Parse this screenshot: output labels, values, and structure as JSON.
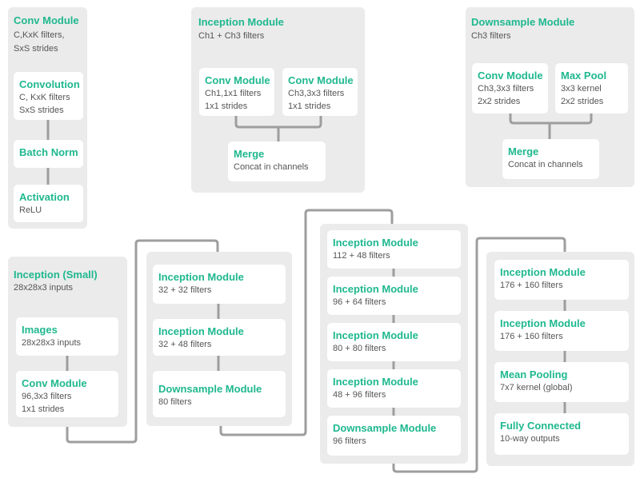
{
  "colors": {
    "accent": "#1fb88f",
    "panel": "#ebebeb",
    "card": "#ffffff",
    "wire": "#9e9e9e",
    "text": "#555555"
  },
  "conv_module": {
    "title": "Conv Module",
    "subtitle": "C,KxK filters,\nSxS strides",
    "cards": [
      {
        "title": "Convolution",
        "subtitle": "C, KxK filters\nSxS strides"
      },
      {
        "title": "Batch Norm",
        "subtitle": ""
      },
      {
        "title": "Activation",
        "subtitle": "ReLU"
      }
    ]
  },
  "inception_module": {
    "title": "Inception Module",
    "subtitle": "Ch1 + Ch3 filters",
    "cards": [
      {
        "title": "Conv Module",
        "subtitle": "Ch1,1x1 filters\n1x1 strides"
      },
      {
        "title": "Conv Module",
        "subtitle": "Ch3,3x3 filters\n1x1 strides"
      },
      {
        "title": "Merge",
        "subtitle": "Concat in channels"
      }
    ]
  },
  "downsample_module": {
    "title": "Downsample Module",
    "subtitle": "Ch3 filters",
    "cards": [
      {
        "title": "Conv Module",
        "subtitle": "Ch3,3x3 filters\n2x2 strides"
      },
      {
        "title": "Max Pool",
        "subtitle": "3x3 kernel\n2x2 strides"
      },
      {
        "title": "Merge",
        "subtitle": "Concat in channels"
      }
    ]
  },
  "inception_small": {
    "title": "Inception (Small)",
    "subtitle": "28x28x3 inputs",
    "cards": [
      {
        "title": "Images",
        "subtitle": "28x28x3 inputs"
      },
      {
        "title": "Conv Module",
        "subtitle": "96,3x3 filters\n1x1 strides"
      }
    ]
  },
  "stage1": {
    "cards": [
      {
        "title": "Inception Module",
        "subtitle": "32 + 32 filters"
      },
      {
        "title": "Inception Module",
        "subtitle": "32 + 48 filters"
      },
      {
        "title": "Downsample Module",
        "subtitle": "80 filters"
      }
    ]
  },
  "stage2": {
    "cards": [
      {
        "title": "Inception Module",
        "subtitle": "112 + 48 filters"
      },
      {
        "title": "Inception Module",
        "subtitle": "96 + 64 filters"
      },
      {
        "title": "Inception Module",
        "subtitle": "80 + 80 filters"
      },
      {
        "title": "Inception Module",
        "subtitle": "48 + 96 filters"
      },
      {
        "title": "Downsample Module",
        "subtitle": "96 filters"
      }
    ]
  },
  "stage3": {
    "cards": [
      {
        "title": "Inception Module",
        "subtitle": "176 + 160 filters"
      },
      {
        "title": "Inception Module",
        "subtitle": "176 + 160 filters"
      },
      {
        "title": "Mean Pooling",
        "subtitle": "7x7 kernel (global)"
      },
      {
        "title": "Fully Connected",
        "subtitle": "10-way outputs"
      }
    ]
  }
}
